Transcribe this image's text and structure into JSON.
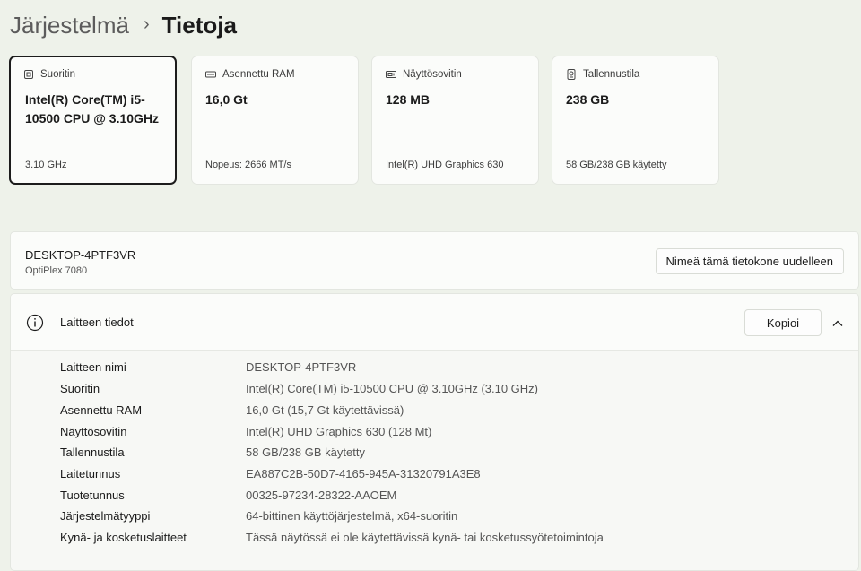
{
  "breadcrumb": {
    "parent": "Järjestelmä",
    "separator": "›",
    "current": "Tietoja"
  },
  "cards": [
    {
      "title": "Suoritin",
      "value": "Intel(R) Core(TM) i5-10500 CPU @ 3.10GHz",
      "sub": "3.10 GHz",
      "icon": "processor-icon"
    },
    {
      "title": "Asennettu RAM",
      "value": "16,0 Gt",
      "sub": "Nopeus: 2666 MT/s",
      "icon": "ram-icon"
    },
    {
      "title": "Näyttösovitin",
      "value": "128 MB",
      "sub": "Intel(R) UHD Graphics 630",
      "icon": "display-adapter-icon"
    },
    {
      "title": "Tallennustila",
      "value": "238 GB",
      "sub": "58 GB/238 GB käytetty",
      "icon": "storage-icon"
    }
  ],
  "device": {
    "name": "DESKTOP-4PTF3VR",
    "model": "OptiPlex 7080",
    "rename_label": "Nimeä tämä tietokone uudelleen"
  },
  "specs": {
    "title": "Laitteen tiedot",
    "copy_label": "Kopioi",
    "rows": [
      {
        "label": "Laitteen nimi",
        "value": "DESKTOP-4PTF3VR"
      },
      {
        "label": "Suoritin",
        "value": "Intel(R) Core(TM) i5-10500 CPU @ 3.10GHz (3.10 GHz)"
      },
      {
        "label": "Asennettu RAM",
        "value": "16,0 Gt (15,7 Gt käytettävissä)"
      },
      {
        "label": "Näyttösovitin",
        "value": "Intel(R) UHD Graphics 630 (128 Mt)"
      },
      {
        "label": "Tallennustila",
        "value": "58 GB/238 GB käytetty"
      },
      {
        "label": "Laitetunnus",
        "value": "EA887C2B-50D7-4165-945A-31320791A3E8"
      },
      {
        "label": "Tuotetunnus",
        "value": "00325-97234-28322-AAOEM"
      },
      {
        "label": "Järjestelmätyyppi",
        "value": "64-bittinen käyttöjärjestelmä, x64-suoritin"
      },
      {
        "label": "Kynä- ja kosketuslaitteet",
        "value": "Tässä näytössä ei ole käytettävissä kynä- tai kosketussyötetoimintoja"
      }
    ]
  }
}
